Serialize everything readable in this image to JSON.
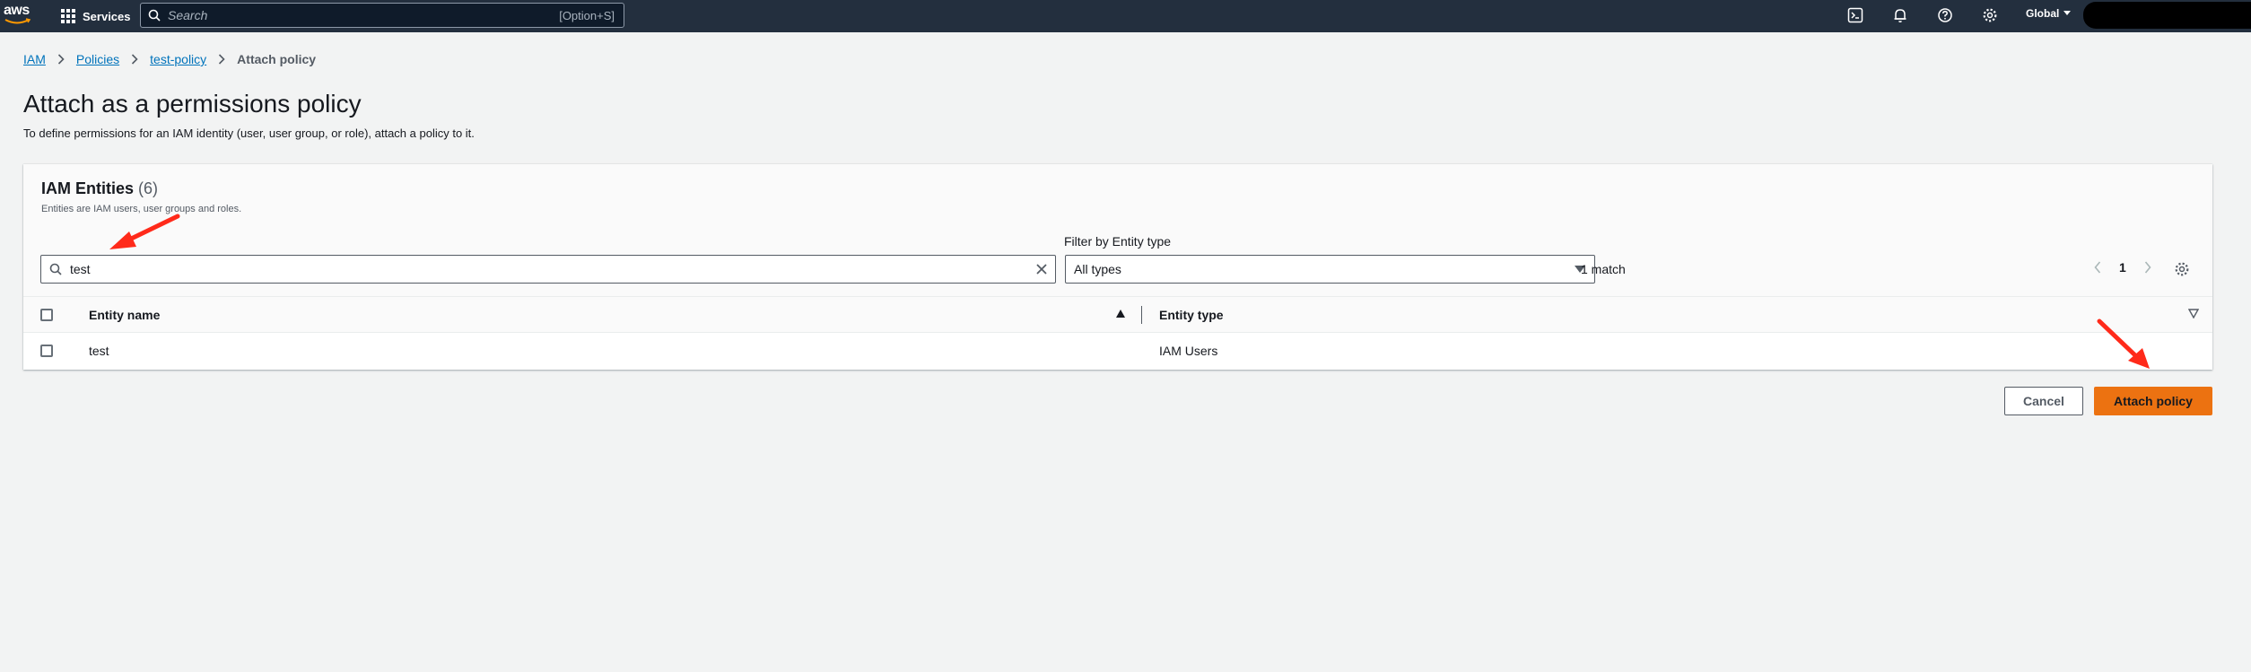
{
  "topnav": {
    "logo_text": "aws",
    "services_label": "Services",
    "search_placeholder": "Search",
    "search_shortcut": "[Option+S]",
    "region_label": "Global",
    "icons": [
      "cloudshell-icon",
      "bell-icon",
      "help-icon",
      "gear-icon"
    ]
  },
  "breadcrumb": {
    "items": [
      "IAM",
      "Policies",
      "test-policy"
    ],
    "current": "Attach policy"
  },
  "page": {
    "title": "Attach as a permissions policy",
    "subtitle": "To define permissions for an IAM identity (user, user group, or role), attach a policy to it."
  },
  "panel": {
    "title": "IAM Entities",
    "count": "(6)",
    "description": "Entities are IAM users, user groups and roles.",
    "search_value": "test",
    "filter_label": "Filter by Entity type",
    "filter_selected": "All types",
    "match_text": "1 match",
    "page_number": "1"
  },
  "table": {
    "columns": [
      "Entity name",
      "Entity type"
    ],
    "rows": [
      {
        "name": "test",
        "type": "IAM Users"
      }
    ]
  },
  "actions": {
    "cancel_label": "Cancel",
    "attach_label": "Attach policy"
  },
  "colors": {
    "nav_bg": "#232f3e",
    "primary": "#ec7211",
    "link": "#0073bb",
    "annotation_arrow": "#ff2a1a"
  }
}
